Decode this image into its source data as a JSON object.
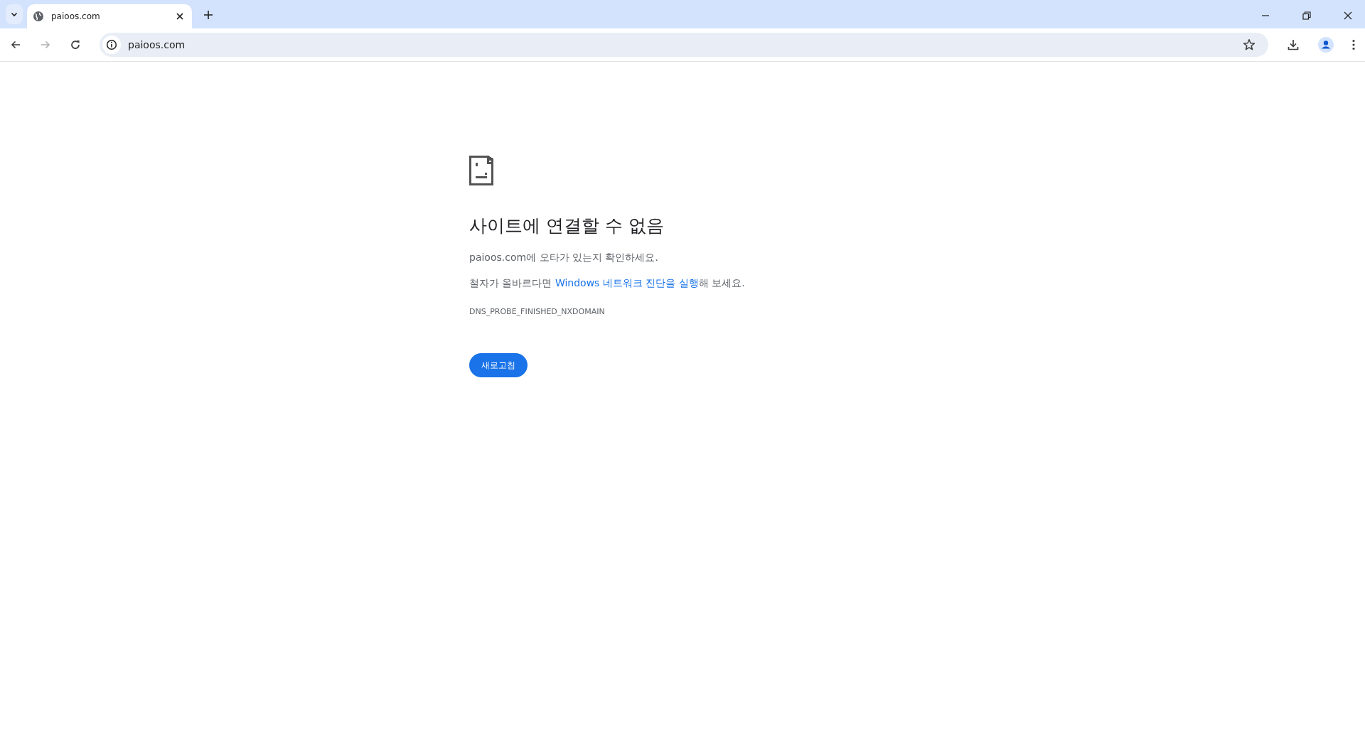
{
  "tabs": [
    {
      "title": "paioos.com",
      "selected": true
    }
  ],
  "address_bar": {
    "url": "paioos.com"
  },
  "error": {
    "title": "사이트에 연결할 수 없음",
    "hint": "paioos.com에 오타가 있는지 확인하세요.",
    "suggestion": {
      "before": "철자가 올바르다면 ",
      "link": "Windows 네트워크 진단을 실행",
      "after": "해 보세요."
    },
    "code": "DNS_PROBE_FINISHED_NXDOMAIN",
    "button": "새로고침"
  }
}
